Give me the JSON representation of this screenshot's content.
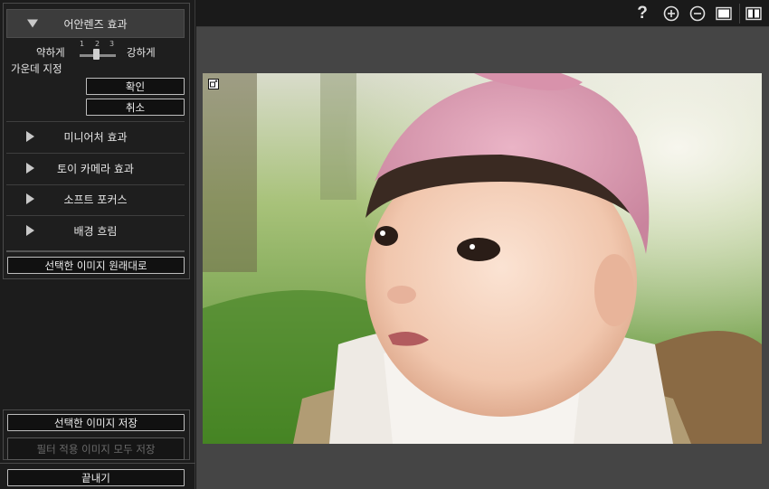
{
  "sidebar": {
    "fisheye": {
      "title": "어안렌즈 효과",
      "weak_label": "약하게",
      "strong_label": "강하게",
      "center_label": "가운데 지정",
      "ticks": [
        "1",
        "2",
        "3"
      ],
      "level": 2,
      "confirm_label": "확인",
      "cancel_label": "취소"
    },
    "effects": [
      {
        "label": "미니어처 효과"
      },
      {
        "label": "토이 카메라 효과"
      },
      {
        "label": "소프트 포커스"
      },
      {
        "label": "배경 흐림"
      }
    ],
    "restore_label": "선택한 이미지 원래대로",
    "save_selected_label": "선택한 이미지 저장",
    "save_all_label": "필터 적용 이미지 모두 저장",
    "exit_label": "끝내기"
  },
  "toolbar": {
    "icons": [
      "help-icon",
      "zoom-in-icon",
      "zoom-out-icon",
      "single-view-icon",
      "compare-view-icon"
    ],
    "help_glyph": "?"
  },
  "colors": {
    "background": "#1a1a1a",
    "canvas": "#454545",
    "active_header": "#3c3c3c"
  }
}
